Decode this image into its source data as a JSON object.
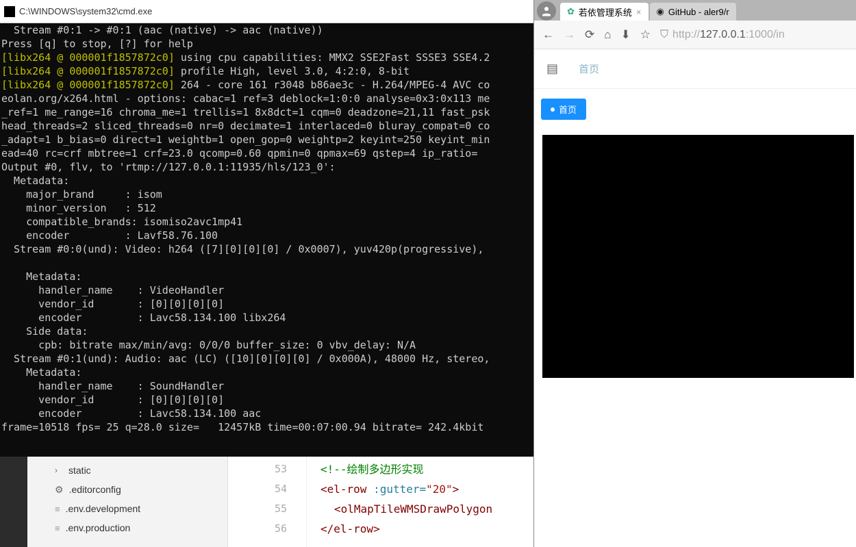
{
  "cmd": {
    "title": "C:\\WINDOWS\\system32\\cmd.exe",
    "lines": [
      {
        "pre": "",
        "text": "  Stream #0:1 -> #0:1 (aac (native) -> aac (native))"
      },
      {
        "pre": "",
        "text": "Press [q] to stop, [?] for help"
      },
      {
        "pre": "y",
        "yellow": "[libx264 @ 000001f1857872c0]",
        "rest": " using cpu capabilities: MMX2 SSE2Fast SSSE3 SSE4.2"
      },
      {
        "pre": "y",
        "yellow": "[libx264 @ 000001f1857872c0]",
        "rest": " profile High, level 3.0, 4:2:0, 8-bit"
      },
      {
        "pre": "y",
        "yellow": "[libx264 @ 000001f1857872c0]",
        "rest": " 264 - core 161 r3048 b86ae3c - H.264/MPEG-4 AVC co"
      },
      {
        "pre": "",
        "text": "eolan.org/x264.html - options: cabac=1 ref=3 deblock=1:0:0 analyse=0x3:0x113 me"
      },
      {
        "pre": "",
        "text": "_ref=1 me_range=16 chroma_me=1 trellis=1 8x8dct=1 cqm=0 deadzone=21,11 fast_psk"
      },
      {
        "pre": "",
        "text": "head_threads=2 sliced_threads=0 nr=0 decimate=1 interlaced=0 bluray_compat=0 co"
      },
      {
        "pre": "",
        "text": "_adapt=1 b_bias=0 direct=1 weightb=1 open_gop=0 weightp=2 keyint=250 keyint_min"
      },
      {
        "pre": "",
        "text": "ead=40 rc=crf mbtree=1 crf=23.0 qcomp=0.60 qpmin=0 qpmax=69 qstep=4 ip_ratio="
      },
      {
        "pre": "",
        "text": "Output #0, flv, to 'rtmp://127.0.0.1:11935/hls/123_0':"
      },
      {
        "pre": "",
        "text": "  Metadata:"
      },
      {
        "pre": "",
        "text": "    major_brand     : isom"
      },
      {
        "pre": "",
        "text": "    minor_version   : 512"
      },
      {
        "pre": "",
        "text": "    compatible_brands: isomiso2avc1mp41"
      },
      {
        "pre": "",
        "text": "    encoder         : Lavf58.76.100"
      },
      {
        "pre": "",
        "text": "  Stream #0:0(und): Video: h264 ([7][0][0][0] / 0x0007), yuv420p(progressive),"
      },
      {
        "pre": "",
        "text": ""
      },
      {
        "pre": "",
        "text": "    Metadata:"
      },
      {
        "pre": "",
        "text": "      handler_name    : VideoHandler"
      },
      {
        "pre": "",
        "text": "      vendor_id       : [0][0][0][0]"
      },
      {
        "pre": "",
        "text": "      encoder         : Lavc58.134.100 libx264"
      },
      {
        "pre": "",
        "text": "    Side data:"
      },
      {
        "pre": "",
        "text": "      cpb: bitrate max/min/avg: 0/0/0 buffer_size: 0 vbv_delay: N/A"
      },
      {
        "pre": "",
        "text": "  Stream #0:1(und): Audio: aac (LC) ([10][0][0][0] / 0x000A), 48000 Hz, stereo,"
      },
      {
        "pre": "",
        "text": "    Metadata:"
      },
      {
        "pre": "",
        "text": "      handler_name    : SoundHandler"
      },
      {
        "pre": "",
        "text": "      vendor_id       : [0][0][0][0]"
      },
      {
        "pre": "",
        "text": "      encoder         : Lavc58.134.100 aac"
      },
      {
        "pre": "",
        "text": "frame=10518 fps= 25 q=28.0 size=   12457kB time=00:07:00.94 bitrate= 242.4kbit"
      }
    ]
  },
  "tree": {
    "items": [
      {
        "icon": "chev",
        "label": "static"
      },
      {
        "icon": "gear",
        "label": ".editorconfig"
      },
      {
        "icon": "file",
        "label": ".env.development"
      },
      {
        "icon": "file",
        "label": ".env.production"
      }
    ]
  },
  "gutter": [
    "53",
    "54",
    "55",
    "56"
  ],
  "codelines": {
    "l1_comment": "<!--绘制多边形实现",
    "l2_open": "<el-row",
    "l2_attr": ":gutter=",
    "l2_val": "\"20\"",
    "l2_close": ">",
    "l3": "<olMapTileWMSDrawPolygon",
    "l4": "</el-row>"
  },
  "browser": {
    "tab1": {
      "title": "若依管理系统"
    },
    "tab2": {
      "title": "GitHub - aler9/r"
    },
    "url_plain": "http://",
    "url_host": "127.0.0.1",
    "url_port": ":1000/in",
    "crumb": "首页",
    "page_tab": "首页"
  }
}
